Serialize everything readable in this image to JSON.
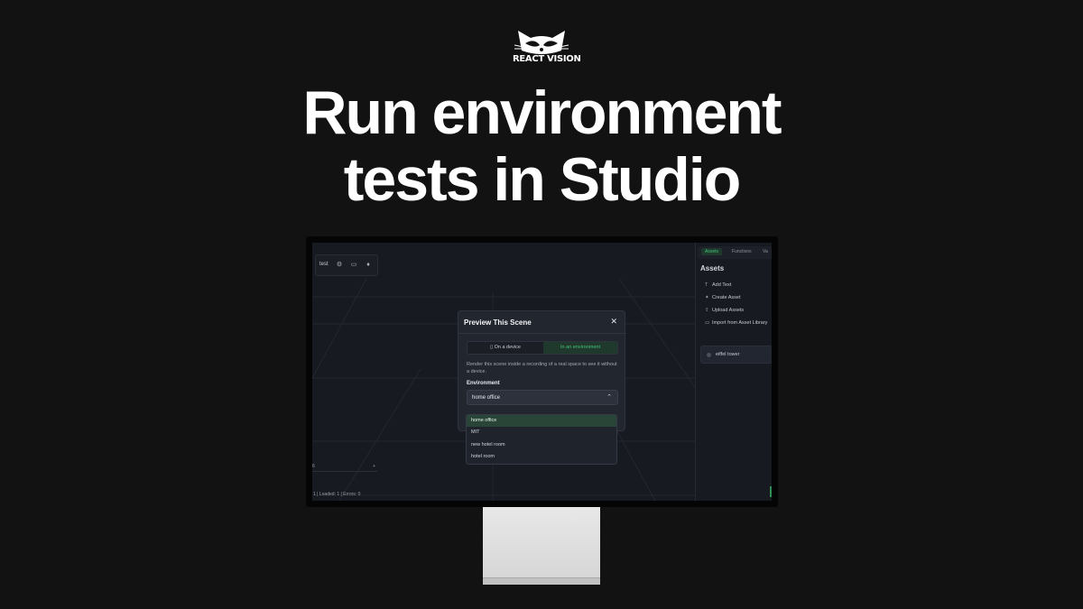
{
  "brand": {
    "name": "REACT VISION"
  },
  "headline": {
    "line1": "Run environment",
    "line2": "tests in Studio"
  },
  "studio": {
    "toolbar": {
      "label": "test",
      "icons": [
        "gear-icon",
        "device-icon",
        "light-icon"
      ]
    },
    "mini_bar": {
      "left": "6",
      "right": "+"
    },
    "status": "1 | Loaded: 1 | Errors: 0",
    "right_panel": {
      "tabs": [
        "Assets",
        "Functions",
        "Va"
      ],
      "active_tab": "Assets",
      "title": "Assets",
      "actions": [
        {
          "icon": "T",
          "label": "Add Text"
        },
        {
          "icon": "✦",
          "label": "Create Asset"
        },
        {
          "icon": "⇪",
          "label": "Upload Assets"
        },
        {
          "icon": "▭",
          "label": "Import from Asset Library"
        }
      ],
      "asset": "eiffel tower"
    },
    "modal": {
      "title": "Preview This Scene",
      "close": "✕",
      "segments": {
        "device": "On a device",
        "environment": "In an environment"
      },
      "description": "Render this scene inside a recording of a real space to see it without a device.",
      "field_label": "Environment",
      "selected": "home office",
      "options": [
        "home office",
        "MIT",
        "new hotel room",
        "hotel room"
      ]
    }
  },
  "colors": {
    "accent": "#46c07a",
    "background": "#121212",
    "panel": "#22262f"
  }
}
